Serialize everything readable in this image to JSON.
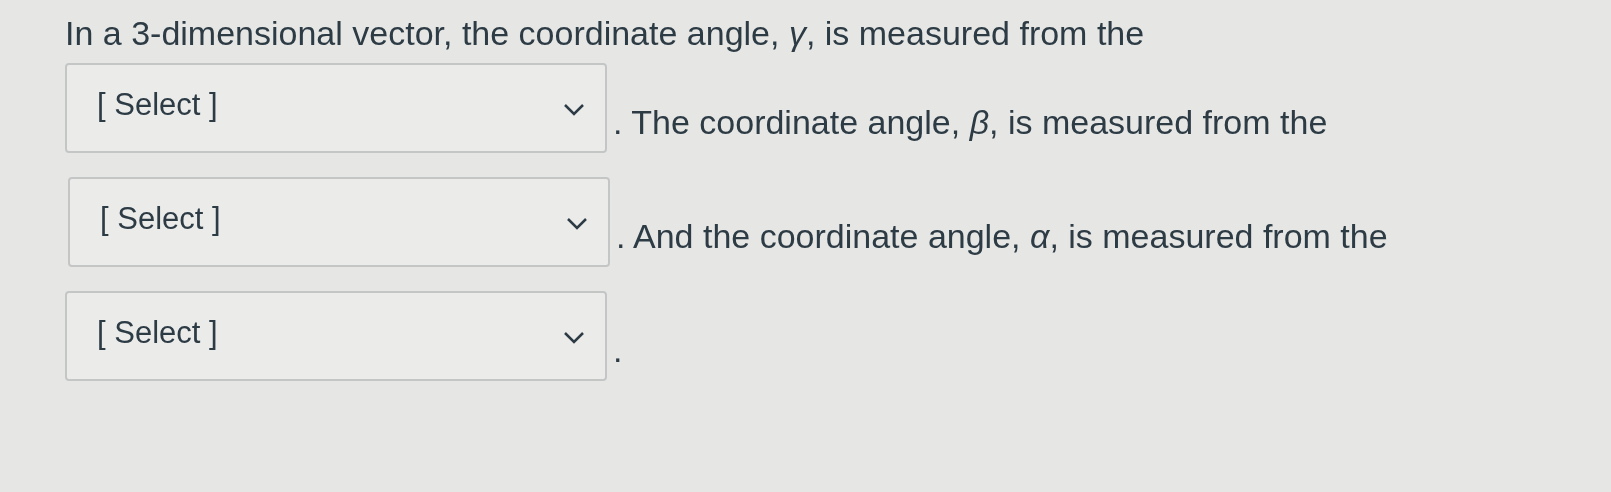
{
  "intro": "In a 3-dimensional vector, the coordinate angle, *γ*, is measured from the",
  "blanks": [
    {
      "value": "[ Select ]",
      "after": ". The coordinate angle, *β*, is measured from the"
    },
    {
      "value": "[ Select ]",
      "after": ". And the coordinate angle, *α*, is measured from the"
    },
    {
      "value": "[ Select ]",
      "after": "."
    }
  ]
}
